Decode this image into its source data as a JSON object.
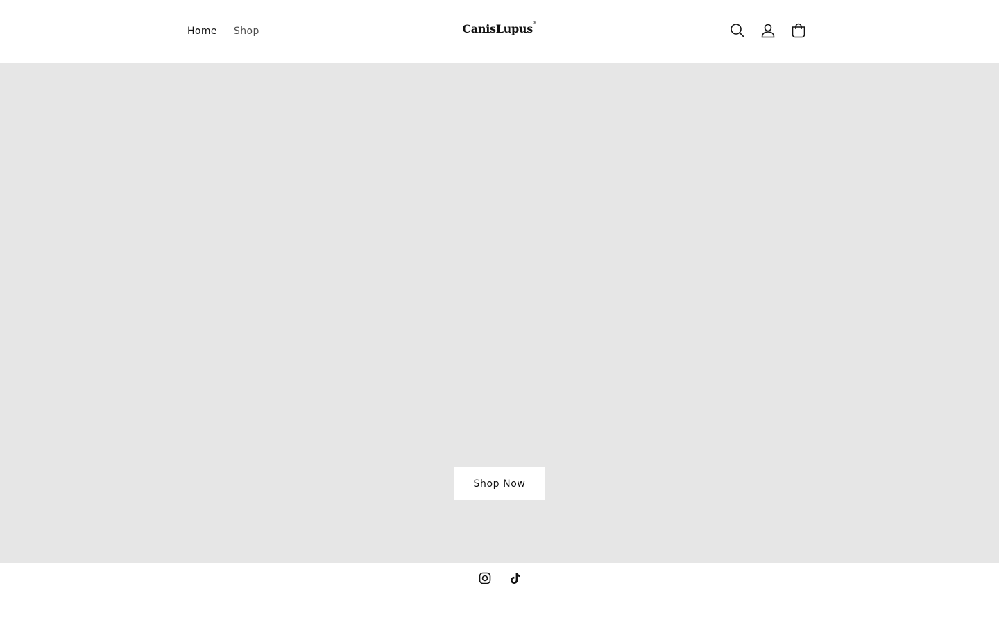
{
  "header": {
    "nav": [
      {
        "label": "Home",
        "active": true
      },
      {
        "label": "Shop",
        "active": false
      }
    ],
    "logo": {
      "text": "CanisLupus",
      "mark": "®"
    },
    "icons": [
      "search-icon",
      "account-icon",
      "cart-icon"
    ]
  },
  "hero": {
    "background_color": "#e6e6e6",
    "cta_label": "Shop Now"
  },
  "footer": {
    "social_icons": [
      "instagram-icon",
      "tiktok-icon"
    ]
  }
}
